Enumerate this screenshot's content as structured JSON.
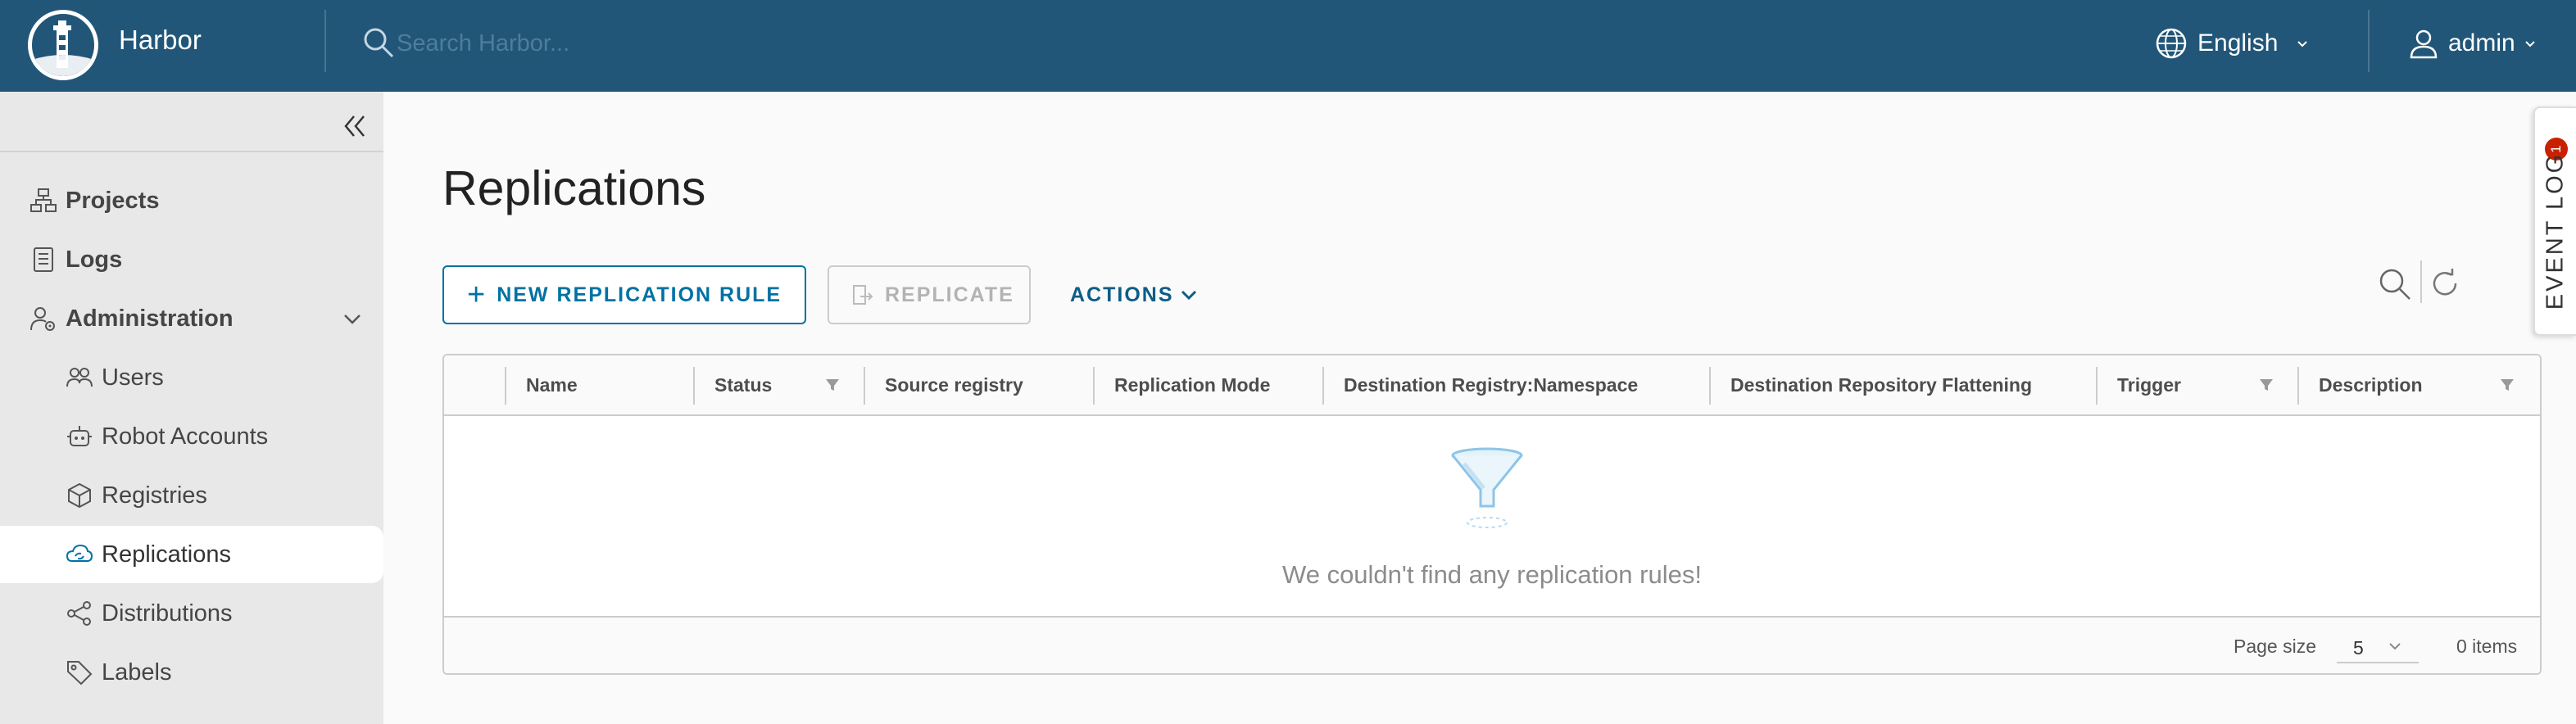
{
  "header": {
    "app_title": "Harbor",
    "search_placeholder": "Search Harbor...",
    "language": "English",
    "user": "admin"
  },
  "sidebar": {
    "items": [
      {
        "label": "Projects",
        "icon": "projects-icon"
      },
      {
        "label": "Logs",
        "icon": "logs-icon"
      },
      {
        "label": "Administration",
        "icon": "administration-icon",
        "expanded": true
      },
      {
        "label": "Users",
        "icon": "users-icon"
      },
      {
        "label": "Robot Accounts",
        "icon": "robot-icon"
      },
      {
        "label": "Registries",
        "icon": "registries-icon"
      },
      {
        "label": "Replications",
        "icon": "replications-icon",
        "active": true
      },
      {
        "label": "Distributions",
        "icon": "distributions-icon"
      },
      {
        "label": "Labels",
        "icon": "labels-icon"
      }
    ]
  },
  "main": {
    "title": "Replications",
    "new_rule_label": "NEW REPLICATION RULE",
    "replicate_label": "REPLICATE",
    "actions_label": "ACTIONS",
    "columns": [
      {
        "label": "Name",
        "filter": false
      },
      {
        "label": "Status",
        "filter": true
      },
      {
        "label": "Source registry",
        "filter": false
      },
      {
        "label": "Replication Mode",
        "filter": false
      },
      {
        "label": "Destination Registry:Namespace",
        "filter": false
      },
      {
        "label": "Destination Repository Flattening",
        "filter": false
      },
      {
        "label": "Trigger",
        "filter": true
      },
      {
        "label": "Description",
        "filter": true
      }
    ],
    "empty_message": "We couldn't find any replication rules!",
    "page_size_label": "Page size",
    "page_size_value": "5",
    "items_count": "0 items"
  },
  "event_log": {
    "label": "EVENT LOG",
    "badge": "1"
  },
  "colors": {
    "header_bg": "#215678",
    "primary": "#0072a3",
    "sidebar_bg": "#e8e8e8",
    "badge": "#c92100"
  }
}
